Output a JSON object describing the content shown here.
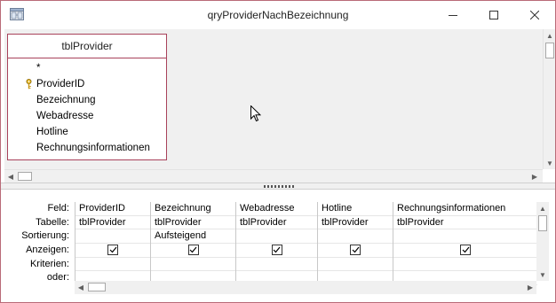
{
  "window": {
    "title": "qryProviderNachBezeichnung"
  },
  "table": {
    "name": "tblProvider",
    "fields": [
      "*",
      "ProviderID",
      "Bezeichnung",
      "Webadresse",
      "Hotline",
      "Rechnungsinformationen"
    ],
    "primary_key_field": "ProviderID"
  },
  "grid": {
    "row_labels": [
      "Feld:",
      "Tabelle:",
      "Sortierung:",
      "Anzeigen:",
      "Kriterien:",
      "oder:"
    ],
    "columns": [
      {
        "field": "ProviderID",
        "table": "tblProvider",
        "sort": "",
        "show": true
      },
      {
        "field": "Bezeichnung",
        "table": "tblProvider",
        "sort": "Aufsteigend",
        "show": true
      },
      {
        "field": "Webadresse",
        "table": "tblProvider",
        "sort": "",
        "show": true
      },
      {
        "field": "Hotline",
        "table": "tblProvider",
        "sort": "",
        "show": true
      },
      {
        "field": "Rechnungsinformationen",
        "table": "tblProvider",
        "sort": "",
        "show": true
      }
    ]
  },
  "colors": {
    "table_border": "#a8425b",
    "pane_background": "#f0f0f0"
  }
}
